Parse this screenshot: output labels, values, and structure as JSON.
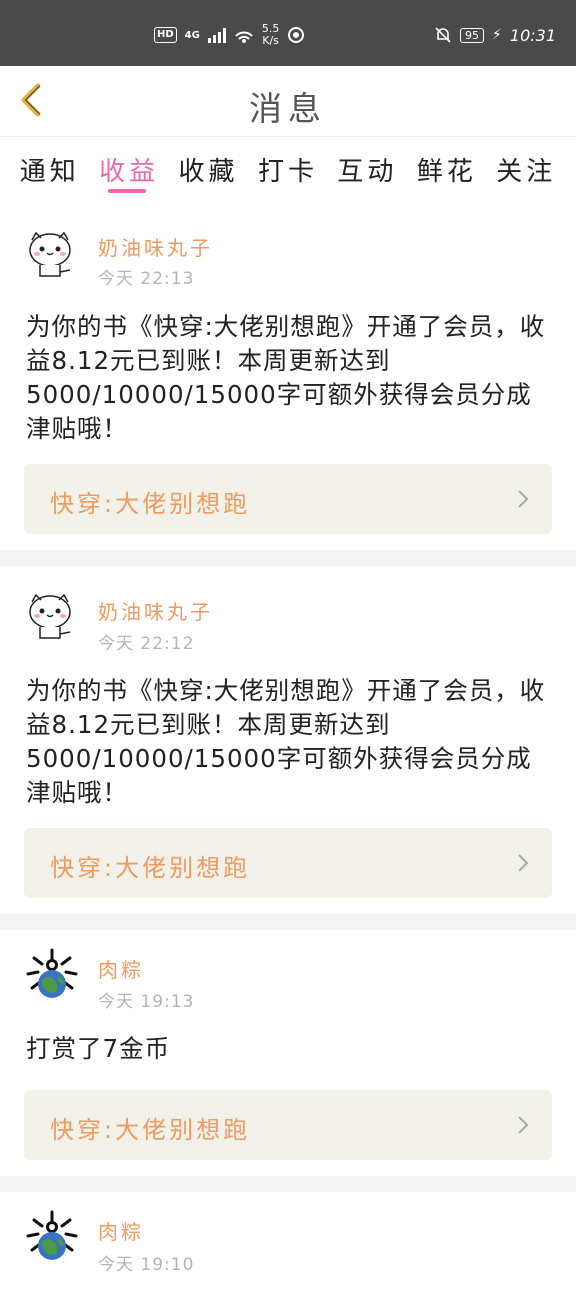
{
  "status_bar": {
    "hd": "HD",
    "network": "4G",
    "speed_value": "5.5",
    "speed_unit": "K/s",
    "battery": "95",
    "time": "10:31"
  },
  "header": {
    "title": "消息"
  },
  "tabs": [
    {
      "label": "通知",
      "active": false
    },
    {
      "label": "收益",
      "active": true
    },
    {
      "label": "收藏",
      "active": false
    },
    {
      "label": "打卡",
      "active": false
    },
    {
      "label": "互动",
      "active": false
    },
    {
      "label": "鲜花",
      "active": false
    },
    {
      "label": "关注",
      "active": false
    }
  ],
  "messages": [
    {
      "user": "奶油味丸子",
      "time": "今天 22:13",
      "avatar": "cat-avatar-icon",
      "text": "为你的书《快穿:大佬别想跑》开通了会员，收益8.12元已到账！本周更新达到5000/10000/15000字可额外获得会员分成津贴哦！",
      "book": "快穿:大佬别想跑"
    },
    {
      "user": "奶油味丸子",
      "time": "今天 22:12",
      "avatar": "cat-avatar-icon",
      "text": "为你的书《快穿:大佬别想跑》开通了会员，收益8.12元已到账！本周更新达到5000/10000/15000字可额外获得会员分成津贴哦！",
      "book": "快穿:大佬别想跑"
    },
    {
      "user": "肉粽",
      "time": "今天 19:13",
      "avatar": "globe-avatar-icon",
      "text": "打赏了7金币",
      "book": "快穿:大佬别想跑"
    },
    {
      "user": "肉粽",
      "time": "今天 19:10",
      "avatar": "globe-avatar-icon",
      "text": "",
      "book": ""
    }
  ],
  "colors": {
    "accent": "#ea6aa9",
    "name": "#ef9a5e",
    "back_arrow": "#e2b23a",
    "status_bar": "#4a4a4a"
  }
}
